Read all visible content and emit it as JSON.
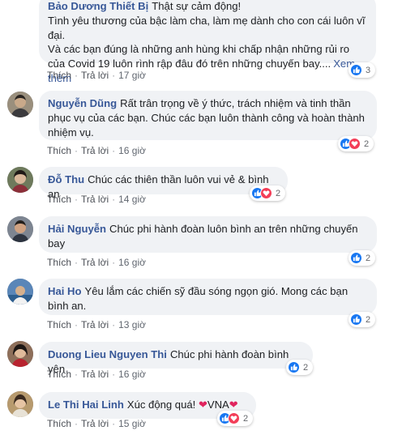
{
  "labels": {
    "like": "Thích",
    "reply": "Trả lời",
    "separator": "·"
  },
  "comments": [
    {
      "author": "Bảo Dương Thiết Bị",
      "text": "Thật sự cảm động!",
      "text2": "Tình yêu thương của bậc làm cha, làm mẹ dành cho con cái luôn vĩ đại.",
      "text3": "Và các bạn đúng là những anh hùng khi chấp nhận những rủi ro của Covid 19 luôn rình rập đâu đó trên những chuyến bay....",
      "more": "Xem thêm",
      "time": "17 giờ",
      "reactions": [
        "like-icon"
      ],
      "count": "3"
    },
    {
      "author": "Nguyễn Dũng",
      "text": "Rất trân trọng về ý thức, trách nhiệm và tinh thần phục vụ của các bạn. Chúc các bạn luôn thành công và hoàn thành nhiệm vụ.",
      "time": "16 giờ",
      "reactions": [
        "like-icon",
        "love-icon"
      ],
      "count": "2"
    },
    {
      "author": "Đỗ Thu",
      "text": "Chúc các thiên thần luôn vui vẻ & bình an",
      "time": "14 giờ",
      "reactions": [
        "like-icon",
        "love-icon"
      ],
      "count": "2"
    },
    {
      "author": "Hải Nguyễn",
      "text": "Chúc phi hành đoàn luôn bình an trên những chuyến bay",
      "time": "16 giờ",
      "reactions": [
        "like-icon"
      ],
      "count": "2"
    },
    {
      "author": "Hai Ho",
      "text": "Yêu lắm các chiến sỹ đầu sóng ngọn gió. Mong các bạn bình an.",
      "time": "13 giờ",
      "reactions": [
        "like-icon"
      ],
      "count": "2"
    },
    {
      "author": "Duong Lieu Nguyen Thi",
      "text": "Chúc phi hành đoàn bình yên",
      "time": "16 giờ",
      "reactions": [
        "like-icon"
      ],
      "count": "2"
    },
    {
      "author": "Le Thi Hai Linh",
      "text": "Xúc động quá!",
      "text_tail": "VNA",
      "time": "15 giờ",
      "reactions": [
        "like-icon",
        "love-icon"
      ],
      "count": "2"
    }
  ]
}
